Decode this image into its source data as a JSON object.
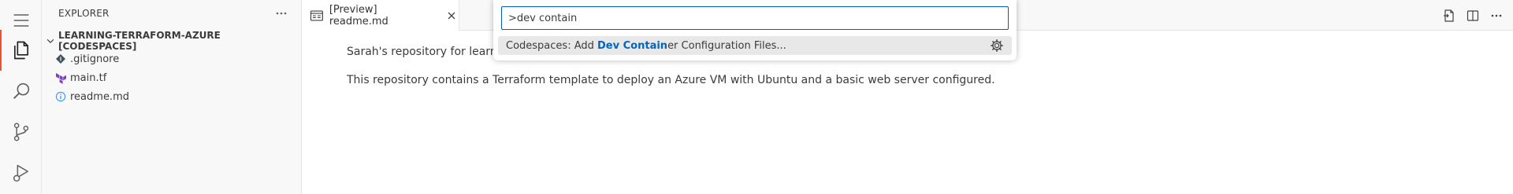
{
  "sidebar": {
    "title": "EXPLORER",
    "folder": "LEARNING-TERRAFORM-AZURE [CODESPACES]",
    "files": [
      {
        "name": ".gitignore"
      },
      {
        "name": "main.tf"
      },
      {
        "name": "readme.md"
      }
    ]
  },
  "tab": {
    "label": "[Preview] readme.md"
  },
  "content": {
    "p1": "Sarah's repository for learni",
    "p2": "This repository contains a Terraform template to deploy an Azure VM with Ubuntu and a basic web server configured."
  },
  "palette": {
    "input_value": ">dev contain",
    "result_prefix": "Codespaces: Add ",
    "result_match": "Dev Contain",
    "result_suffix": "er Configuration Files..."
  },
  "colors": {
    "accent": "#005fb8",
    "active_indicator": "#f1502f",
    "highlight": "#0066bf"
  }
}
